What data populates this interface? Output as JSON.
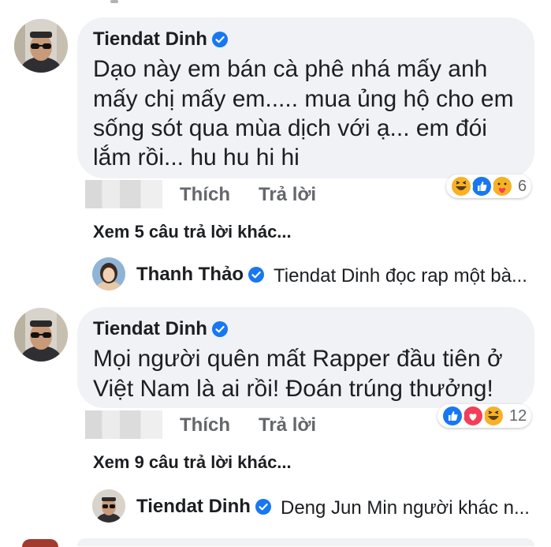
{
  "colors": {
    "bubble": "#f0f2f5",
    "verified": "#1877f2",
    "action_text": "#65676b",
    "like": "#1877f2",
    "love": "#f33e58",
    "haha": "#f7b125"
  },
  "comments": [
    {
      "author": "Tiendat Dinh",
      "verified": true,
      "lines": [
        "Dạo này em bán cà phê nhá mấy anh",
        "mấy chị mấy em..... mua ủng hộ cho em",
        "sống sót qua mùa dịch với ạ... em đói",
        "lắm rồi... hu hu hi hi"
      ],
      "actions": {
        "like": "Thích",
        "reply": "Trả lời"
      },
      "reactions": {
        "icons": [
          "haha-icon",
          "like-icon",
          "care-icon"
        ],
        "count": "6"
      },
      "more_replies": "Xem 5 câu trả lời khác...",
      "reply_preview": {
        "author": "Thanh Thảo",
        "verified": true,
        "text": "Tiendat Dinh đọc rap một bà..."
      }
    },
    {
      "author": "Tiendat Dinh",
      "verified": true,
      "lines": [
        "Mọi người quên mất Rapper đầu tiên ở",
        "Việt Nam là ai rồi! Đoán trúng thưởng!"
      ],
      "actions": {
        "like": "Thích",
        "reply": "Trả lời"
      },
      "reactions": {
        "icons": [
          "like-icon",
          "love-icon",
          "haha-icon"
        ],
        "count": "12"
      },
      "more_replies": "Xem 9 câu trả lời khác...",
      "reply_preview": {
        "author": "Tiendat Dinh",
        "verified": true,
        "text": "Deng Jun Min người khác n..."
      }
    }
  ]
}
